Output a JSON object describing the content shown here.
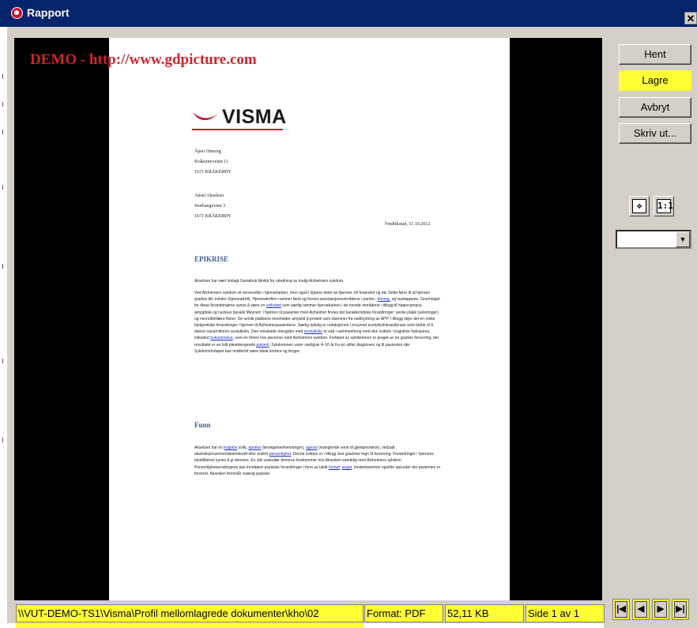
{
  "window": {
    "title": "Rapport",
    "close_glyph": "✕"
  },
  "watermark": "DEMO - http://www.gdpicture.com",
  "document": {
    "logo_text": "VISMA",
    "sender": [
      "Åpen Omsorg",
      "Kråkerøyveien 11",
      "1671 KRÅKERØY"
    ],
    "recipient": [
      "Aksel Akselsen",
      "Storhaugveien 3",
      "1671 KRÅKERØY"
    ],
    "date": "Fredrikstad, 31.10.2012",
    "heading1": "EPIKRISE",
    "intro": "Akselsen har vært innlagt Geriatrisk klinikk for utredning av mulig Alzheimers sykdom.",
    "p1a": "Ved Alzheimers sykdom vil nerveceller i hjernebarken, men også i dypere deler av hjernen, bli forandret og dø. Dette fører til at hjernen gradvis blir mindre (hjerneatrofi). Hjerneatrofien rammer først og fremst assosiasjonsområdene i panne-,",
    "p1_link1": "tinning-",
    "p1b": "og isselappene. Grunnlaget for disse forandringene synes å være en",
    "p1_link2": "celledød",
    "p1c": "som særlig rammer hjernebarken i de nevnte områdene i tillegg til hippocampus, amygdala og nucleus basalis Meynert. I hjernen til pasienter med Alzheimer finnes det karakteristiske forandringer: senile plakk (avleiringer) og nevrofibrillære floker. De senile plakkene inneholder amyloid β-protein som stammer fra nedbrytning av APP. I tillegg skjer det en rekke biokjemiske forandringer i hjernen til Alzheimerpasientene. Særlig tydelig er reduksjonen i enzymet acetylkolintransferase som bidrar til å danne transmittoren acetylkolin. Den minskede mengden med",
    "p1_link3": "acetylkolin",
    "p1d": "er satt i sammenheng med den svikten i kognitive funksjoner, inkludert",
    "p1_link4": "hukommelse",
    "p1e": ", som en finner hos personer med Alzheimers sykdom. Forløpet av sykdommen er preget av en gradvis forverring, der resultatet er en fullt pleietrengende",
    "p1_link5": "pasient",
    "p1f": ". Sykdommen varer vanligvis 4–10 år fra en stiller diagnosen og til pasienten dør. Sykdomsforløpet kan imidlertid være både kortere og lengre.",
    "heading2": "Funn",
    "p2a": "Akselsen har en",
    "p2_link1": "kognitiv",
    "p2b": "svikt,",
    "p2_link2": "apraksi",
    "p2c": "(bevegelseshemninger),",
    "p2_link3": "agnosi",
    "p2d": "(manglende evne til gjenkjennelse), nedsatt abstraksjonsevne/dømmekraft eller endret",
    "p2_link4": "personlighet",
    "p2e": ". Denne svikten er i tillegg vise gradvise tegn til forverring. Forandringer i hjernens blodtilførsel synes å gi demens. En slik vaskulær demens forekommer hos Akselsen samtidig med Alzheimers sykdom. Personlighetsendringene kan innebære psykiske forandringer i form av labilt",
    "p2_link5": "humør",
    "p2_sep": ",",
    "p2_link6": "angst",
    "p2f": ", mistenksomhet og/eller episoder der pasienten er forvirret. Akselsen fremstår svævig passive."
  },
  "buttons": {
    "hent": "Hent",
    "lagre": "Lagre",
    "avbryt": "Avbryt",
    "skriv_ut": "Skriv ut..."
  },
  "zoom": {
    "fit_glyph": "✥",
    "actual_glyph": "1:1",
    "select_value": "",
    "select_arrow": "▼"
  },
  "status": {
    "path": "\\\\VUT-DEMO-TS1\\Visma\\Profil mellomlagrede dokumenter\\kho\\02",
    "format": "Format: PDF",
    "size": "52,11 KB",
    "page": "Side 1 av 1"
  },
  "nav": {
    "first": "|◀",
    "prev": "◀",
    "next": "▶",
    "last": "▶|"
  },
  "colors": {
    "titlebar": "#06246b",
    "highlight": "#ffff33",
    "watermark": "#d0232a",
    "visma_red": "#c8102e"
  }
}
